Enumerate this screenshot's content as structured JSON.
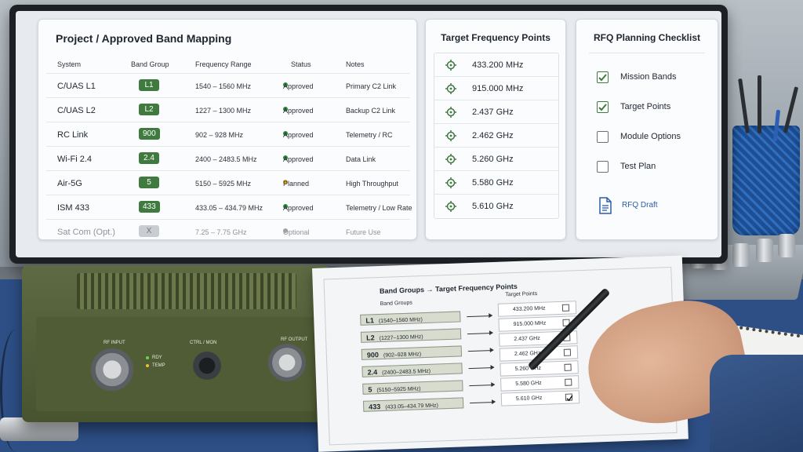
{
  "band_mapping": {
    "title": "Project / Approved Band Mapping",
    "columns": [
      "System",
      "Band Group",
      "Frequency Range",
      "Status",
      "Notes"
    ],
    "rows": [
      {
        "system": "C/UAS L1",
        "band": "L1",
        "range": "1540 – 1560 MHz",
        "status": "Approved",
        "status_color": "#2e8b3a",
        "notes": "Primary C2 Link"
      },
      {
        "system": "C/UAS L2",
        "band": "L2",
        "range": "1227 – 1300 MHz",
        "status": "Approved",
        "status_color": "#2e8b3a",
        "notes": "Backup C2 Link"
      },
      {
        "system": "RC Link",
        "band": "900",
        "range": "902 – 928 MHz",
        "status": "Approved",
        "status_color": "#2e8b3a",
        "notes": "Telemetry / RC"
      },
      {
        "system": "Wi-Fi 2.4",
        "band": "2.4",
        "range": "2400 – 2483.5 MHz",
        "status": "Approved",
        "status_color": "#2e8b3a",
        "notes": "Data Link"
      },
      {
        "system": "Air-5G",
        "band": "5",
        "range": "5150 – 5925 MHz",
        "status": "Planned",
        "status_color": "#e0a81e",
        "notes": "High Throughput"
      },
      {
        "system": "ISM 433",
        "band": "433",
        "range": "433.05 – 434.79 MHz",
        "status": "Approved",
        "status_color": "#2e8b3a",
        "notes": "Telemetry / Low Rate"
      },
      {
        "system": "Sat Com (Opt.)",
        "band": "X",
        "range": "7.25 – 7.75 GHz",
        "status": "Optional",
        "status_color": "#a3a8ae",
        "notes": "Future Use"
      }
    ]
  },
  "target_points": {
    "title": "Target Frequency Points",
    "icon": "target-crosshair-icon",
    "items": [
      "433.200  MHz",
      "915.000  MHz",
      "2.437  GHz",
      "2.462  GHz",
      "5.260  GHz",
      "5.580  GHz",
      "5.610  GHz"
    ]
  },
  "rfq_checklist": {
    "title": "RFQ Planning Checklist",
    "items": [
      {
        "label": "Mission Bands",
        "checked": true
      },
      {
        "label": "Target Points",
        "checked": true
      },
      {
        "label": "Module Options",
        "checked": false
      },
      {
        "label": "Test Plan",
        "checked": false
      }
    ],
    "draft_label": "RFQ Draft",
    "draft_icon": "document-icon"
  },
  "radio_unit": {
    "rf_input": "RF INPUT",
    "rdy": "RDY",
    "temp": "TEMP",
    "ctrl": "CTRL / MON",
    "rf_output": "RF OUTPUT"
  },
  "paper_sheet": {
    "title": "Band Groups  →  Target Frequency Points",
    "left_head": "Band Groups",
    "right_head": "Target Points",
    "bands": [
      {
        "code": "L1",
        "range": "(1540–1560 MHz)"
      },
      {
        "code": "L2",
        "range": "(1227–1300 MHz)"
      },
      {
        "code": "900",
        "range": "(902–928 MHz)"
      },
      {
        "code": "2.4",
        "range": "(2400–2483.5 MHz)"
      },
      {
        "code": "5",
        "range": "(5150–5925 MHz)"
      },
      {
        "code": "433",
        "range": "(433.05–434.79 MHz)"
      }
    ],
    "points": [
      {
        "label": "433.200 MHz",
        "checked": false
      },
      {
        "label": "915.000 MHz",
        "checked": false
      },
      {
        "label": "2.437 GHz",
        "checked": false
      },
      {
        "label": "2.462 GHz",
        "checked": false
      },
      {
        "label": "5.260 GHz",
        "checked": false
      },
      {
        "label": "5.580 GHz",
        "checked": false
      },
      {
        "label": "5.610 GHz",
        "checked": true
      }
    ]
  },
  "colors": {
    "accent_green": "#3f7a3f",
    "link_blue": "#2b5fa8"
  }
}
